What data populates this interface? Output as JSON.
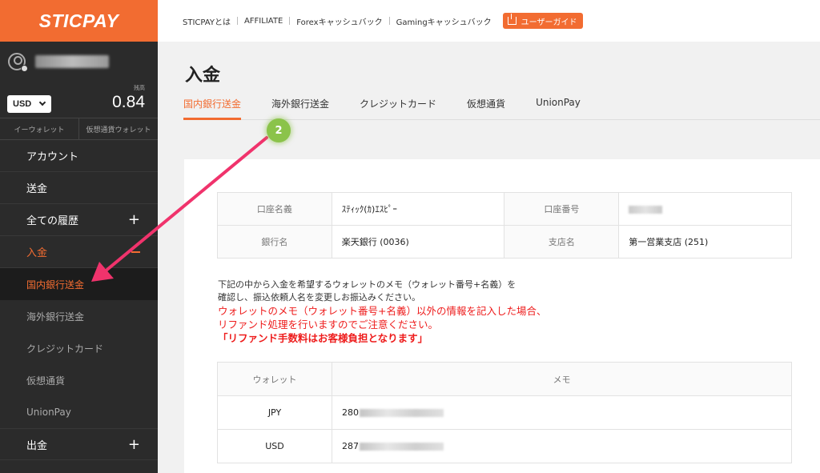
{
  "brand": {
    "logo": "STICPAY",
    "accent_color": "#f26c31"
  },
  "sidebar": {
    "balance_label": "残高",
    "balance_value": "0.84",
    "currency": "USD",
    "wallet_tabs": [
      "イーウォレット",
      "仮想通貨ウォレット"
    ],
    "nav": [
      {
        "label": "アカウント"
      },
      {
        "label": "送金"
      },
      {
        "label": "全ての履歴"
      },
      {
        "label": "入金"
      },
      {
        "label": "出金"
      }
    ],
    "sub_items": [
      "国内銀行送金",
      "海外銀行送金",
      "クレジットカード",
      "仮想通貨",
      "UnionPay"
    ]
  },
  "topbar": {
    "links": [
      "STICPAYとは",
      "AFFILIATE",
      "Forexキャッシュバック",
      "Gamingキャッシュバック"
    ],
    "guide_button": "ユーザーガイド"
  },
  "main": {
    "title": "入金",
    "tabs": [
      "国内銀行送金",
      "海外銀行送金",
      "クレジットカード",
      "仮想通貨",
      "UnionPay"
    ],
    "bank_info": {
      "account_name_label": "口座名義",
      "account_name_value": "ｽﾃｨｯｸ(ｶ)ｴｽﾋﾟｰ",
      "account_number_label": "口座番号",
      "bank_label": "銀行名",
      "bank_value": "楽天銀行 (0036)",
      "branch_label": "支店名",
      "branch_value": "第一営業支店 (251)"
    },
    "notes": {
      "line1": "下記の中から入金を希望するウォレットのメモ（ウォレット番号+名義）を",
      "line2": "確認し、振込依頼人名を変更しお振込みください。",
      "warn1": "ウォレットのメモ（ウォレット番号+名義）以外の情報を記入した場合、",
      "warn2": "リファンド処理を行いますのでご注意ください。",
      "warn3": "「リファンド手数料はお客様負担となります」"
    },
    "wallet_table": {
      "headers": [
        "ウォレット",
        "メモ"
      ],
      "rows": [
        {
          "currency": "JPY",
          "memo": "280"
        },
        {
          "currency": "USD",
          "memo": "287"
        }
      ]
    }
  },
  "annotation": {
    "step": "2"
  }
}
